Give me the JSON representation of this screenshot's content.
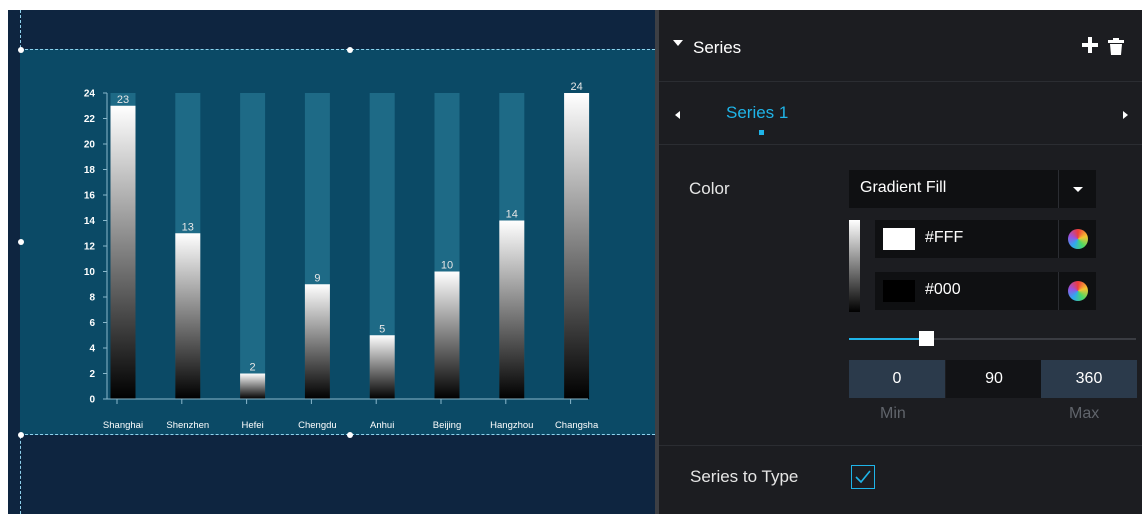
{
  "panel": {
    "title": "Series",
    "add_icon": "plus-icon",
    "delete_icon": "trash-icon",
    "tab": "Series 1",
    "color_label": "Color",
    "fill_mode": "Gradient Fill",
    "stops": [
      {
        "value": "#FFF",
        "swatch": "#ffffff"
      },
      {
        "value": "#000",
        "swatch": "#000000"
      }
    ],
    "angle_slider_fraction": 0.27,
    "range": {
      "min_value": "0",
      "mid_value": "90",
      "max_value": "360",
      "min_label": "Min",
      "max_label": "Max"
    },
    "series_type_label": "Series to Type",
    "series_type_checked": true,
    "accent_color": "#1fb4e8"
  },
  "chart_data": {
    "type": "bar",
    "categories": [
      "Shanghai",
      "Shenzhen",
      "Hefei",
      "Chengdu",
      "Anhui",
      "Beijing",
      "Hangzhou",
      "Changsha"
    ],
    "series": [
      {
        "values": [
          23,
          13,
          2,
          9,
          5,
          10,
          14,
          24
        ]
      }
    ],
    "y_ticks": [
      "0",
      "2",
      "4",
      "6",
      "8",
      "10",
      "12",
      "14",
      "16",
      "18",
      "20",
      "22",
      "24"
    ],
    "ylim": [
      0,
      24
    ],
    "background_bars": true,
    "gradient": [
      "#ffffff",
      "#000000"
    ],
    "colors": {
      "background_bar": "#1e6a86",
      "axis": "#8ab8cc"
    }
  }
}
